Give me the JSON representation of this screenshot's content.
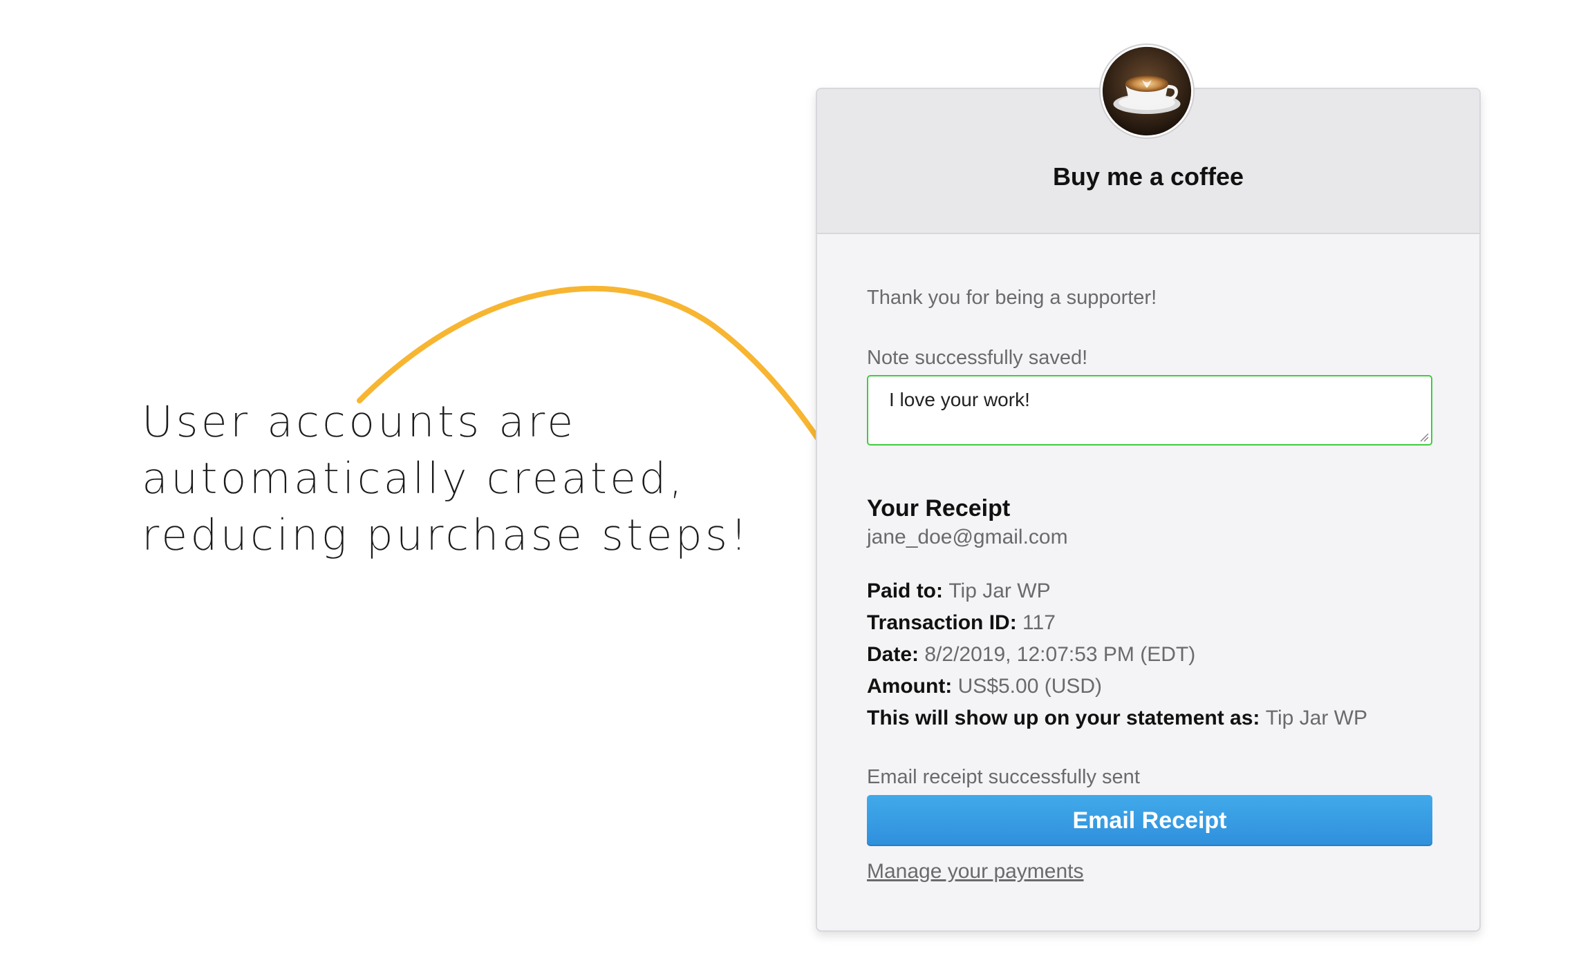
{
  "annotation": {
    "lines": [
      "User accounts are",
      "automatically created,",
      "reducing purchase steps!"
    ],
    "accent_color": "#f7b531"
  },
  "card": {
    "avatar_icon": "coffee-cup-icon",
    "title": "Buy me a coffee",
    "thanks_text": "Thank you for being a supporter!",
    "note_status": "Note successfully saved!",
    "note_value": "I love your work!",
    "receipt": {
      "title": "Your Receipt",
      "email": "jane_doe@gmail.com",
      "details": [
        {
          "label": "Paid to:",
          "value": "Tip Jar WP"
        },
        {
          "label": "Transaction ID:",
          "value": "117"
        },
        {
          "label": "Date:",
          "value": "8/2/2019, 12:07:53 PM (EDT)"
        },
        {
          "label": "Amount:",
          "value": "US$5.00 (USD)"
        },
        {
          "label": "This will show up on your statement as:",
          "value": "Tip Jar WP"
        }
      ]
    },
    "email_status": "Email receipt successfully sent",
    "email_button_label": "Email Receipt",
    "manage_link": "Manage your payments",
    "colors": {
      "button": "#3a9ee4",
      "note_border": "#3fcc3f"
    }
  }
}
